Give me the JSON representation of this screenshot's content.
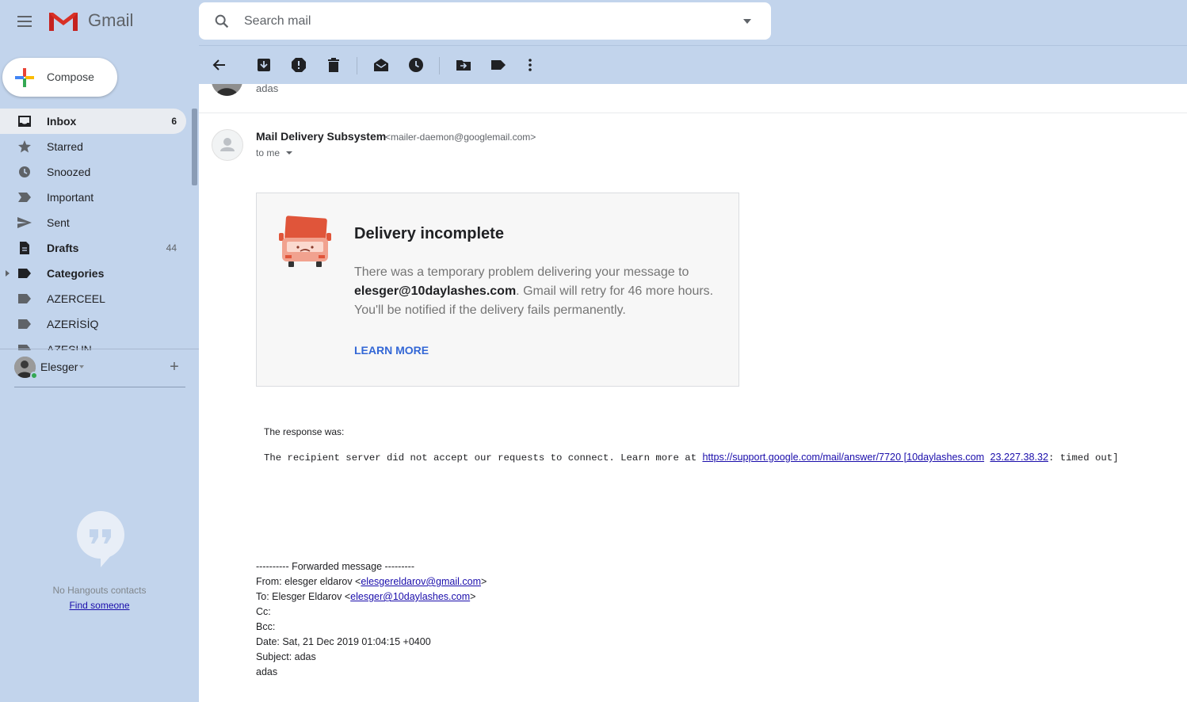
{
  "app": {
    "name": "Gmail",
    "brand_colors": {
      "red": "#d93025",
      "sidebar_bg": "#c2d4ec",
      "link": "#1a0dab",
      "accent_blue": "#3367d6"
    }
  },
  "search": {
    "placeholder": "Search mail"
  },
  "compose": {
    "label": "Compose"
  },
  "sidebar": {
    "items": [
      {
        "label": "Inbox",
        "count": "6",
        "icon": "inbox-icon",
        "active": true,
        "bold": true
      },
      {
        "label": "Starred",
        "count": "",
        "icon": "star-icon"
      },
      {
        "label": "Snoozed",
        "count": "",
        "icon": "clock-icon"
      },
      {
        "label": "Important",
        "count": "",
        "icon": "important-icon"
      },
      {
        "label": "Sent",
        "count": "",
        "icon": "send-icon"
      },
      {
        "label": "Drafts",
        "count": "44",
        "icon": "draft-icon",
        "bold": true
      },
      {
        "label": "Categories",
        "count": "",
        "icon": "label-icon",
        "bold": true
      },
      {
        "label": "AZERCEEL",
        "count": "",
        "icon": "label-icon"
      },
      {
        "label": "AZERİSİQ",
        "count": "",
        "icon": "label-icon"
      },
      {
        "label": "AZESUN",
        "count": "",
        "icon": "label-icon"
      }
    ]
  },
  "hangouts": {
    "username": "Elesger",
    "empty_text": "No Hangouts contacts",
    "find_link": "Find someone"
  },
  "toolbar": {
    "icons": [
      "back-icon",
      "archive-icon",
      "report-spam-icon",
      "delete-icon",
      "mark-unread-icon",
      "snooze-icon",
      "move-to-icon",
      "labels-icon",
      "more-icon"
    ]
  },
  "previous_message": {
    "snippet": "adas"
  },
  "message": {
    "sender_name": "Mail Delivery Subsystem",
    "sender_email": "<mailer-daemon@googlemail.com>",
    "to": "to me",
    "notice": {
      "title": "Delivery incomplete",
      "body_prefix": "There was a temporary problem delivering your message to ",
      "recipient": "elesger@10daylashes.com",
      "body_suffix": ". Gmail will retry for 46 more hours. You'll be notified if the delivery fails permanently.",
      "learn_more": "LEARN MORE"
    },
    "response_label": "The response was:",
    "response_prefix": "The recipient server did not accept our requests to connect. Learn more at ",
    "response_link1": "https://support.google.com/mail/answer/7720 [10daylashes.com",
    "response_link2": "23.227.38.32",
    "response_suffix": ": timed out]",
    "forwarded": {
      "header": "---------- Forwarded message ---------",
      "from_prefix": "From: elesger eldarov <",
      "from_email": "elesgereldarov@gmail.com",
      "from_suffix": ">",
      "to_prefix": "To: Elesger Eldarov <",
      "to_email": "elesger@10daylashes.com",
      "to_suffix": ">",
      "cc": "Cc:",
      "bcc": "Bcc:",
      "date": "Date: Sat, 21 Dec 2019 01:04:15 +0400",
      "subject": "Subject: adas",
      "body": "adas"
    }
  }
}
